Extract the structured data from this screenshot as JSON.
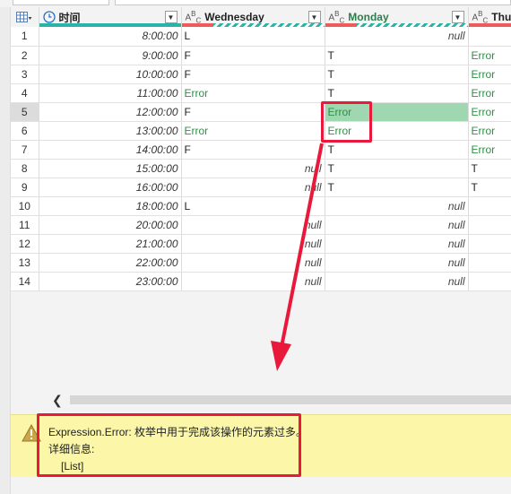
{
  "columns": [
    {
      "name": "时间",
      "type_icon": "clock-icon"
    },
    {
      "name": "Wednesday",
      "type_icon": "abc-type-icon"
    },
    {
      "name": "Monday",
      "type_icon": "abc-type-icon",
      "selected": true
    },
    {
      "name": "Thur",
      "type_icon": "abc-type-icon"
    }
  ],
  "rows": [
    {
      "n": "1",
      "time": "8:00:00",
      "wed": "L",
      "mon": "null",
      "thu": ""
    },
    {
      "n": "2",
      "time": "9:00:00",
      "wed": "F",
      "mon": "T",
      "thu": "Error"
    },
    {
      "n": "3",
      "time": "10:00:00",
      "wed": "F",
      "mon": "T",
      "thu": "Error"
    },
    {
      "n": "4",
      "time": "11:00:00",
      "wed": "Error",
      "mon": "T",
      "thu": "Error"
    },
    {
      "n": "5",
      "time": "12:00:00",
      "wed": "F",
      "mon": "Error",
      "thu": "Error"
    },
    {
      "n": "6",
      "time": "13:00:00",
      "wed": "Error",
      "mon": "Error",
      "thu": "Error"
    },
    {
      "n": "7",
      "time": "14:00:00",
      "wed": "F",
      "mon": "T",
      "thu": "Error"
    },
    {
      "n": "8",
      "time": "15:00:00",
      "wed": "null",
      "mon": "T",
      "thu": "T"
    },
    {
      "n": "9",
      "time": "16:00:00",
      "wed": "null",
      "mon": "T",
      "thu": "T"
    },
    {
      "n": "10",
      "time": "18:00:00",
      "wed": "L",
      "mon": "null",
      "thu": ""
    },
    {
      "n": "11",
      "time": "20:00:00",
      "wed": "null",
      "mon": "null",
      "thu": ""
    },
    {
      "n": "12",
      "time": "21:00:00",
      "wed": "null",
      "mon": "null",
      "thu": ""
    },
    {
      "n": "13",
      "time": "22:00:00",
      "wed": "null",
      "mon": "null",
      "thu": ""
    },
    {
      "n": "14",
      "time": "23:00:00",
      "wed": "null",
      "mon": "null",
      "thu": ""
    }
  ],
  "error_panel": {
    "line1": "Expression.Error: 枚举中用于完成该操作的元素过多。",
    "line2": "详细信息:",
    "line3": "[List]"
  },
  "colors": {
    "error_text": "#2f8f45",
    "highlight": "#9fd8b0",
    "annotation": "#e8193a",
    "warning_bg": "#fbf6a8"
  }
}
